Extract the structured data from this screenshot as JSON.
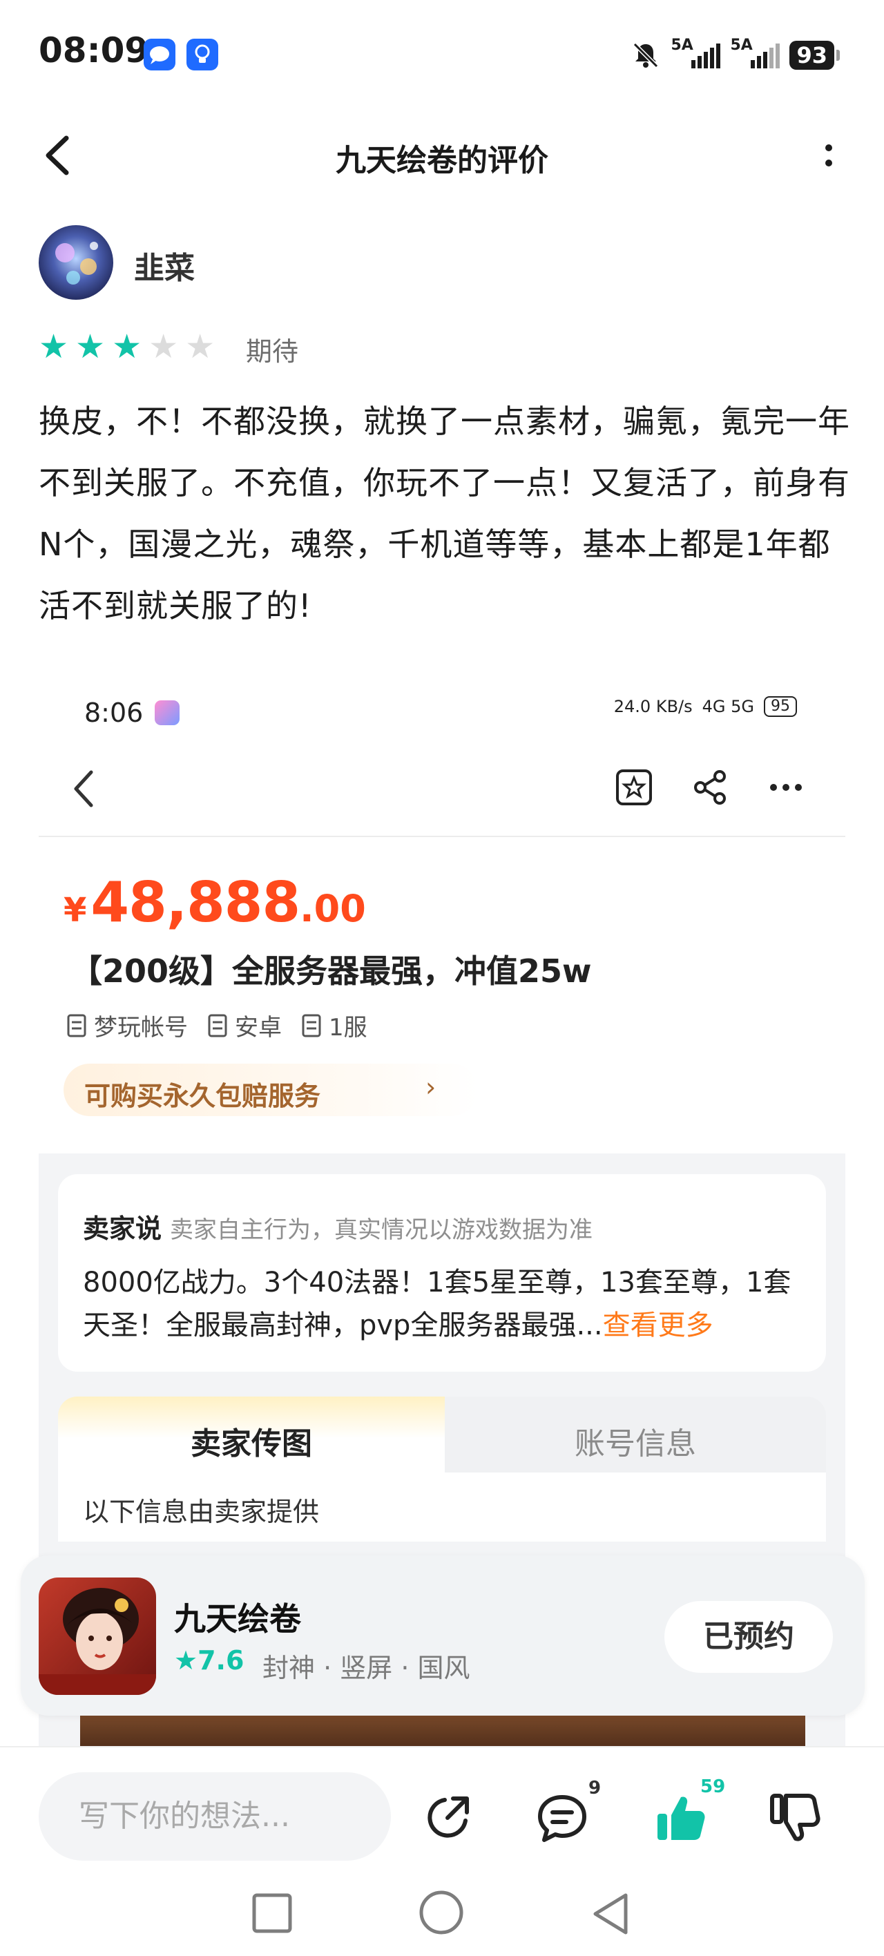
{
  "status_bar": {
    "time": "08:09",
    "signal1": "5A",
    "signal2": "5A",
    "battery": "93"
  },
  "nav": {
    "title": "九天绘卷的评价"
  },
  "review": {
    "user": "韭菜",
    "rating": 3,
    "rating_max": 5,
    "rating_label": "期待",
    "text": "换皮，不！不都没换，就换了一点素材，骗氪，氪完一年不到关服了。不充值，你玩不了一点！又复活了，前身有N个，国漫之光，魂祭，千机道等等，基本上都是1年都活不到就关服了的!"
  },
  "screenshot": {
    "status_time": "8:06",
    "status_speed": "24.0 KB/s",
    "status_net": "4G 5G",
    "status_battery": "95",
    "price_currency": "¥",
    "price_integer": "48,888",
    "price_decimal": ".00",
    "title": "【200级】全服务器最强，冲值25w",
    "tags": [
      "梦玩帐号",
      "安卓",
      "1服"
    ],
    "guarantee": "可购买永久包赔服务",
    "seller_label": "卖家说",
    "seller_note": "卖家自主行为，真实情况以游戏数据为准",
    "seller_text": "8000亿战力。3个40法器！1套5星至尊，13套至尊，1套天圣！全服最高封神，pvp全服务器最强...",
    "seller_more": "查看更多",
    "tab_active": "卖家传图",
    "tab_inactive": "账号信息",
    "provided_by": "以下信息由卖家提供"
  },
  "game_card": {
    "name": "九天绘卷",
    "score": "7.6",
    "tags": "封神 · 竖屏 · 国风",
    "button": "已预约"
  },
  "bottom_bar": {
    "input_placeholder": "写下你的想法...",
    "comment_count": "9",
    "like_count": "59"
  },
  "colors": {
    "accent": "#12c3a8",
    "price": "#ff4a1c",
    "star_off": "#dcdcdc"
  }
}
